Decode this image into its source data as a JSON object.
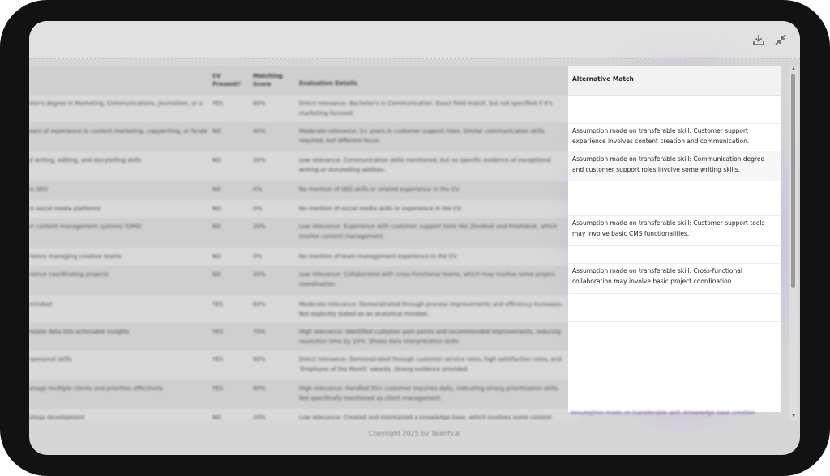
{
  "toolbar": {
    "download_icon": "download-icon",
    "collapse_icon": "collapse-icon"
  },
  "table": {
    "headers": {
      "requirement": "",
      "cv_present": "CV Present?",
      "matching_score": "Matching Score",
      "evaluation_details": "Evaluation Details",
      "alternative_match": "Alternative Match"
    },
    "rows": [
      {
        "req": "elor's degree in Marketing, Communications, Journalism, or a",
        "cv": "YES",
        "score": "80%",
        "details": "Direct relevance: Bachelor's in Communication. Exact field match, but not specified if it's marketing-focused.",
        "alt": ""
      },
      {
        "req": "ears of experience in content marketing, copywriting, or ferably within an agency setting)",
        "cv": "NO",
        "score": "40%",
        "details": "Moderate relevance: 3+ years in customer support roles. Similar communication skills required, but different focus.",
        "alt": "Assumption made on transferable skill: Customer support experience involves content creation and communication."
      },
      {
        "req": "d writing, editing, and storytelling skills",
        "cv": "NO",
        "score": "30%",
        "details": "Low relevance: Communication skills mentioned, but no specific evidence of exceptional writing or storytelling abilities.",
        "alt": "Assumption made on transferable skill: Communication degree and customer support roles involve some writing skills."
      },
      {
        "req": "in SEO",
        "cv": "NO",
        "score": "0%",
        "details": "No mention of SEO skills or related experience in the CV.",
        "alt": ""
      },
      {
        "req": "in social media platforms",
        "cv": "NO",
        "score": "0%",
        "details": "No mention of social media skills or experience in the CV.",
        "alt": ""
      },
      {
        "req": "in content management systems (CMS)",
        "cv": "NO",
        "score": "20%",
        "details": "Low relevance: Experience with customer support tools like Zendesk and Freshdesk, which involve content management.",
        "alt": "Assumption made on transferable skill: Customer support tools may involve basic CMS functionalities."
      },
      {
        "req": "rience managing creative teams",
        "cv": "NO",
        "score": "0%",
        "details": "No mention of team management experience in the CV.",
        "alt": ""
      },
      {
        "req": "rience coordinating projects",
        "cv": "NO",
        "score": "20%",
        "details": "Low relevance: Collaborated with cross-functional teams, which may involve some project coordination.",
        "alt": "Assumption made on transferable skill: Cross-functional collaboration may involve basic project coordination."
      },
      {
        "req": "mindset",
        "cv": "YES",
        "score": "60%",
        "details": "Moderate relevance: Demonstrated through process improvements and efficiency increases. Not explicitly stated as an analytical mindset.",
        "alt": ""
      },
      {
        "req": "nslate data into actionable insights",
        "cv": "YES",
        "score": "70%",
        "details": "High relevance: Identified customer pain points and recommended improvements, reducing resolution time by 15%. Shows data interpretation skills.",
        "alt": ""
      },
      {
        "req": "rpersonal skills",
        "cv": "YES",
        "score": "90%",
        "details": "Direct relevance: Demonstrated through customer service roles, high satisfaction rates, and 'Employee of the Month' awards. Strong evidence provided.",
        "alt": ""
      },
      {
        "req": "anage multiple clients and priorities effectively",
        "cv": "YES",
        "score": "80%",
        "details": "High relevance: Handled 50+ customer inquiries daily, indicating strong prioritization skills. Not specifically mentioned as client management.",
        "alt": ""
      },
      {
        "req": "ategy development",
        "cv": "NO",
        "score": "20%",
        "details": "Low relevance: Created and maintained a knowledge base, which involves some content",
        "alt": "Assumption made on transferable skill: Knowledge base creation"
      }
    ]
  },
  "footer": {
    "copyright": "Copyright 2025 by Talenfy.ai"
  }
}
